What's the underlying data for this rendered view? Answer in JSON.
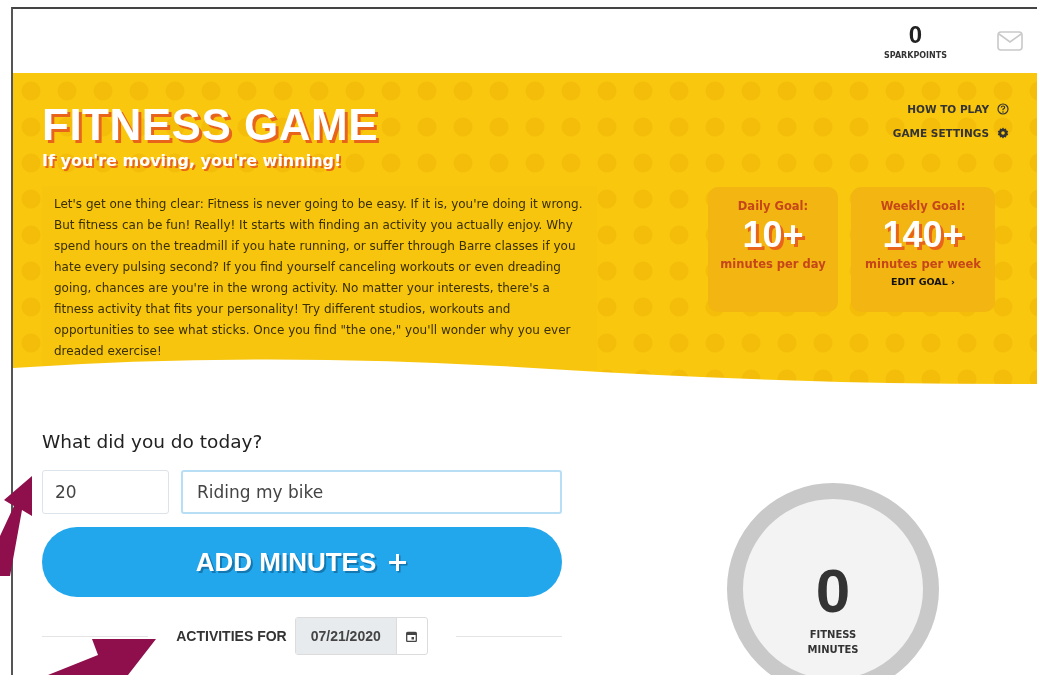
{
  "header": {
    "sparkpoints": {
      "value": "0",
      "label": "SPARKPOINTS"
    }
  },
  "banner": {
    "title": "FITNESS GAME",
    "subtitle": "If you're moving, you're winning!",
    "links": [
      {
        "label": "HOW TO PLAY",
        "kind": "help"
      },
      {
        "label": "GAME SETTINGS",
        "kind": "settings"
      }
    ],
    "intro": "Let's get one thing clear: Fitness is never going to be easy. If it is, you're doing it wrong. But fitness can be fun! Really! It starts with finding an activity you actually enjoy. Why spend hours on the treadmill if you hate running, or suffer through Barre classes if you hate every pulsing second? If you find yourself canceling workouts or even dreading going, chances are you're in the wrong activity. No matter your interests, there's a fitness activity that fits your personality! Try different studios, workouts and opportunities to see what sticks. Once you find \"the one,\" you'll wonder why you ever dreaded exercise!",
    "goals": [
      {
        "label": "Daily Goal:",
        "value": "10+",
        "unit": "minutes per day"
      },
      {
        "label": "Weekly Goal:",
        "value": "140+",
        "unit": "minutes per week",
        "link": "EDIT GOAL ›"
      }
    ]
  },
  "log": {
    "heading": "What did you do today?",
    "minutes": {
      "value": "20"
    },
    "activity": {
      "value": "Riding my bike"
    },
    "button": "ADD MINUTES",
    "activities_for": {
      "label": "ACTIVITIES FOR",
      "date": "07/21/2020"
    }
  },
  "progress": {
    "value": "0",
    "label": "FITNESS MINUTES"
  }
}
